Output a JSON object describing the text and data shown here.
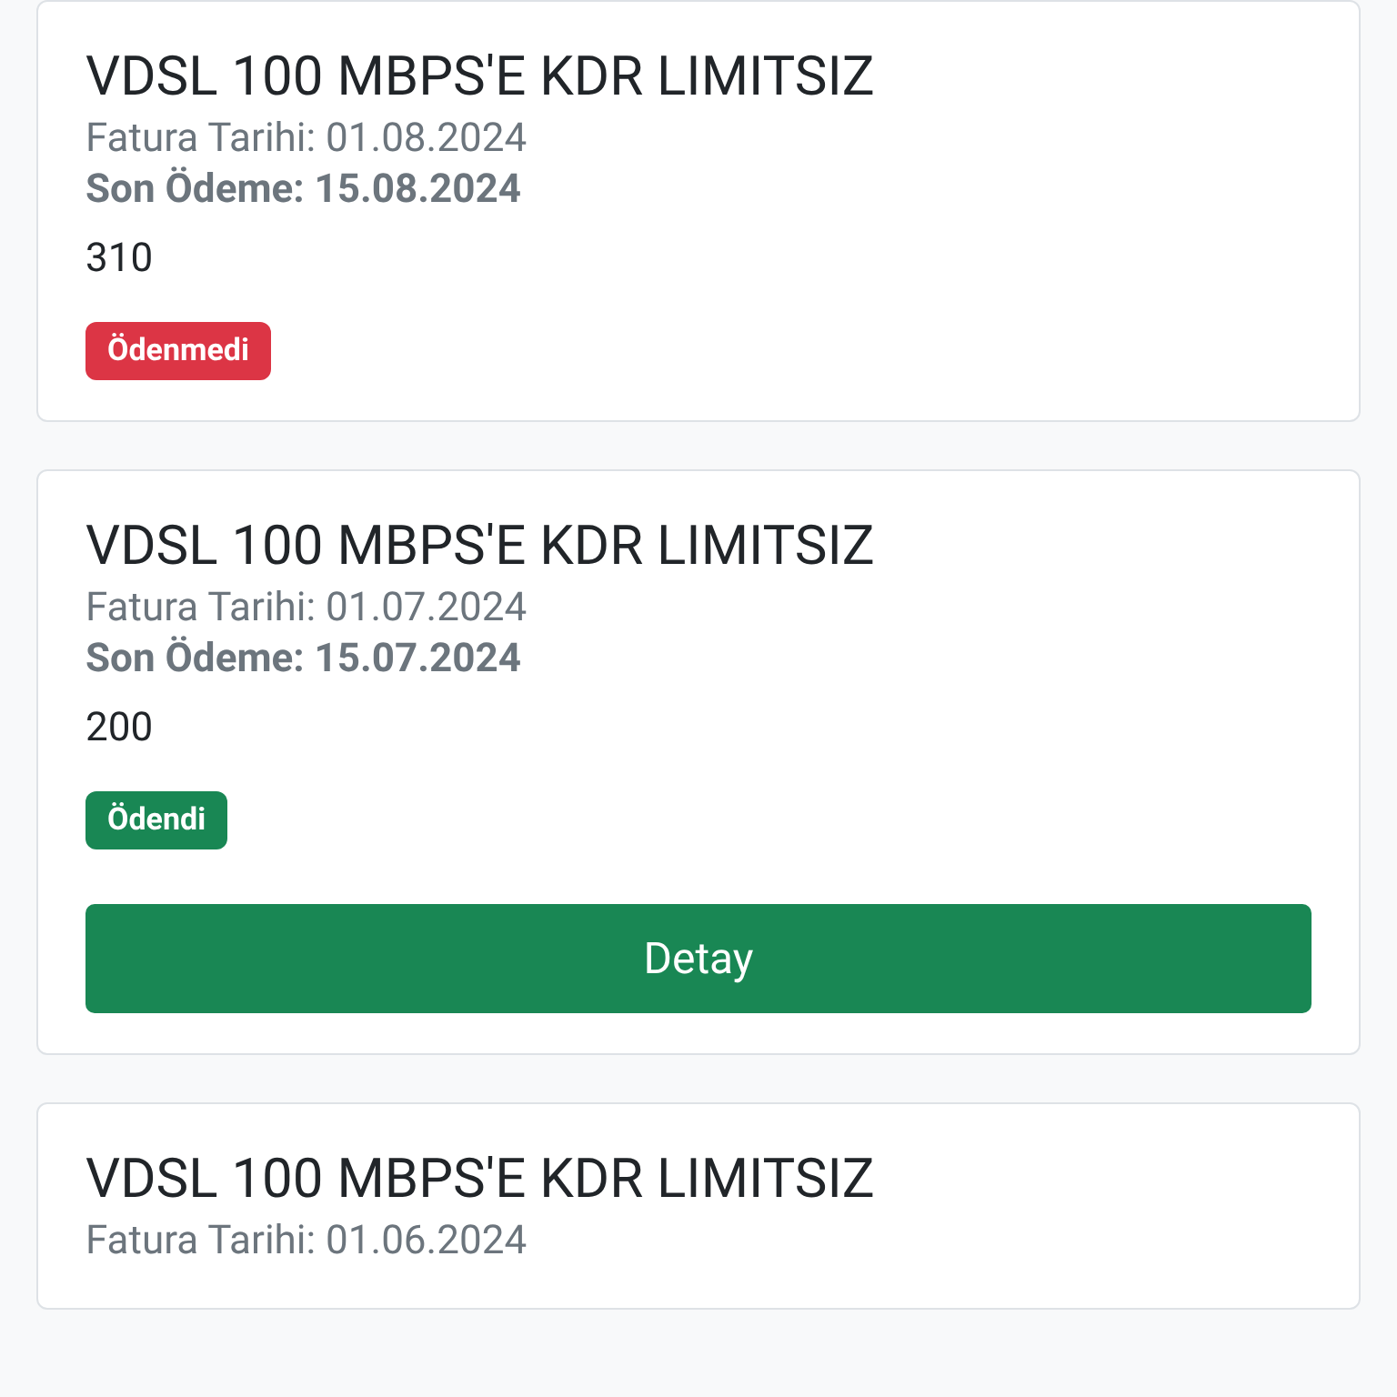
{
  "invoices": [
    {
      "title": "VDSL 100 MBPS'E KDR LIMITSIZ",
      "invoice_date": "Fatura Tarihi: 01.08.2024",
      "due_date": "Son Ödeme: 15.08.2024",
      "amount": "310",
      "status": {
        "kind": "unpaid",
        "label": "Ödenmedi"
      }
    },
    {
      "title": "VDSL 100 MBPS'E KDR LIMITSIZ",
      "invoice_date": "Fatura Tarihi: 01.07.2024",
      "due_date": "Son Ödeme: 15.07.2024",
      "amount": "200",
      "status": {
        "kind": "paid",
        "label": "Ödendi"
      },
      "button": "Detay"
    },
    {
      "title": "VDSL 100 MBPS'E KDR LIMITSIZ",
      "invoice_date": "Fatura Tarihi: 01.06.2024"
    }
  ]
}
